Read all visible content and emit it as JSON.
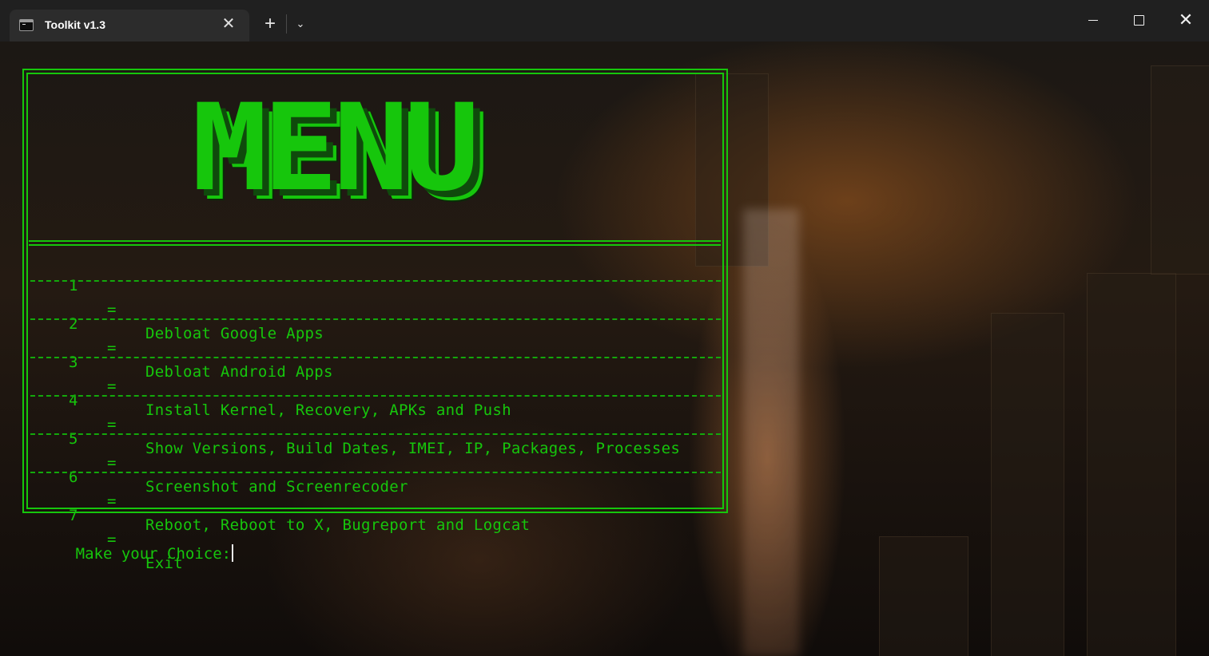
{
  "window": {
    "tab_title": "Toolkit v1.3",
    "tab_icon": "terminal-icon",
    "close_tab_glyph": "✕",
    "new_tab_glyph": "+",
    "dropdown_glyph": "⌄",
    "controls": {
      "minimize": "minimize-icon",
      "maximize": "maximize-icon",
      "close": "close-icon",
      "close_glyph": "✕"
    }
  },
  "menu": {
    "logo": "MENU",
    "items": [
      {
        "number": "1",
        "sep": "=",
        "label": "Debloat Google Apps"
      },
      {
        "number": "2",
        "sep": "=",
        "label": "Debloat Android Apps"
      },
      {
        "number": "3",
        "sep": "=",
        "label": "Install Kernel, Recovery, APKs and Push"
      },
      {
        "number": "4",
        "sep": "=",
        "label": "Show Versions, Build Dates, IMEI, IP, Packages, Processes"
      },
      {
        "number": "5",
        "sep": "=",
        "label": "Screenshot and Screenrecoder"
      },
      {
        "number": "6",
        "sep": "=",
        "label": "Reboot, Reboot to X, Bugreport and Logcat"
      },
      {
        "number": "7",
        "sep": "=",
        "label": "Exit"
      }
    ]
  },
  "prompt": {
    "text": "Make your Choice:"
  },
  "colors": {
    "terminal_green": "#16c60c",
    "titlebar": "#202020",
    "tab_active": "#2c2c2c"
  }
}
